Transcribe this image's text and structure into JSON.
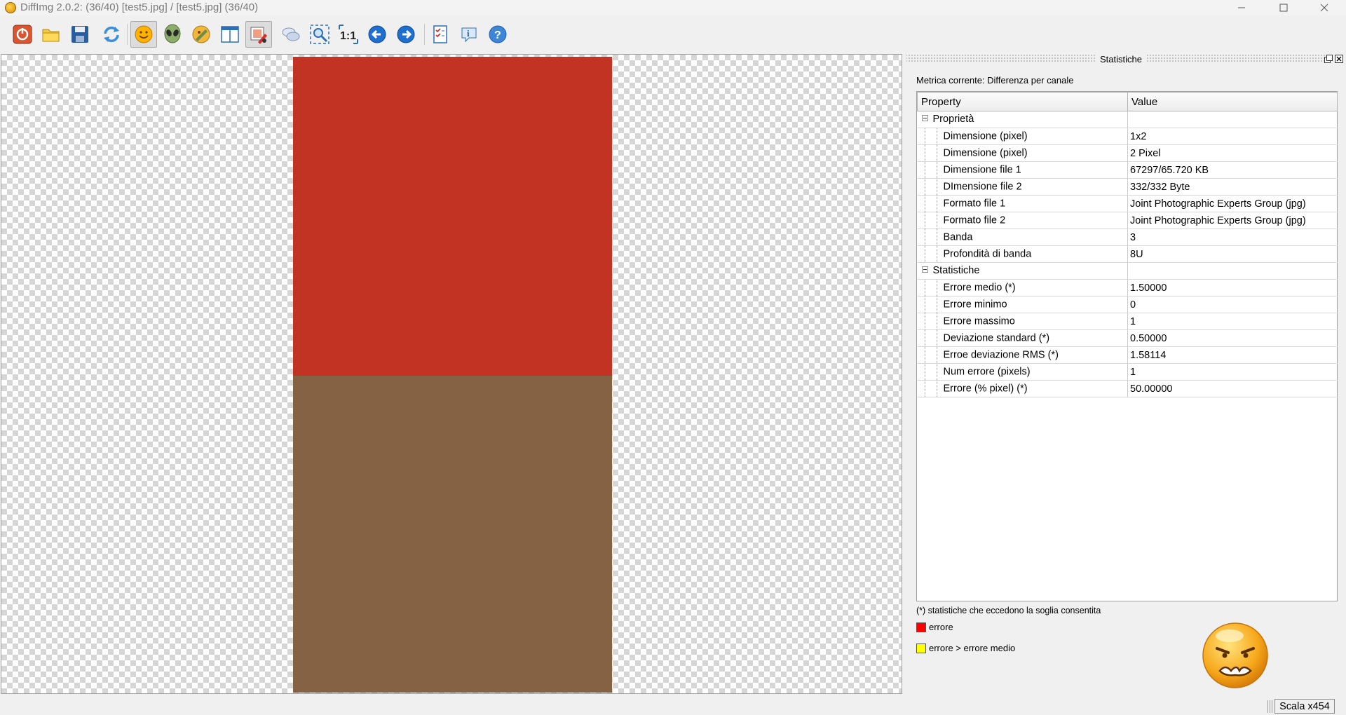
{
  "window": {
    "title": "DiffImg 2.0.2:  (36/40) [test5.jpg] / [test5.jpg] (36/40)"
  },
  "toolbar": {
    "buttons": [
      {
        "icon": "power-icon",
        "pressed": false
      },
      {
        "icon": "open-folder-icon",
        "pressed": false
      },
      {
        "icon": "save-icon",
        "pressed": false
      },
      {
        "icon": "refresh-icon",
        "pressed": false
      },
      {
        "icon": "smiley-icon",
        "pressed": true
      },
      {
        "icon": "alien-icon",
        "pressed": false
      },
      {
        "icon": "paint-blend-icon",
        "pressed": false
      },
      {
        "icon": "split-view-icon",
        "pressed": false
      },
      {
        "icon": "highlight-error-icon",
        "pressed": true
      },
      {
        "icon": "chat-bubbles-icon",
        "pressed": false
      },
      {
        "icon": "zoom-fit-icon",
        "pressed": false
      },
      {
        "icon": "zoom-1-1-icon",
        "pressed": false
      },
      {
        "icon": "previous-arrow-icon",
        "pressed": false
      },
      {
        "icon": "next-arrow-icon",
        "pressed": false
      },
      {
        "icon": "checklist-icon",
        "pressed": false
      },
      {
        "icon": "info-icon",
        "pressed": false
      },
      {
        "icon": "help-icon",
        "pressed": false
      }
    ]
  },
  "canvas": {
    "pixel_colors": [
      "#c33324",
      "#866245"
    ]
  },
  "stats_panel": {
    "title": "Statistiche",
    "metric_label": "Metrica corrente: Differenza per canale",
    "table": {
      "header_property": "Property",
      "header_value": "Value",
      "groups": [
        {
          "name": "Proprietà",
          "rows": [
            {
              "property": "Dimensione (pixel)",
              "value": "1x2"
            },
            {
              "property": "Dimensione (pixel)",
              "value": "2 Pixel"
            },
            {
              "property": "Dimensione file 1",
              "value": "67297/65.720 KB"
            },
            {
              "property": "DImensione file 2",
              "value": "332/332 Byte"
            },
            {
              "property": "Formato file 1",
              "value": "Joint Photographic Experts Group (jpg)"
            },
            {
              "property": "Formato file 2",
              "value": "Joint Photographic Experts Group (jpg)"
            },
            {
              "property": "Banda",
              "value": "3"
            },
            {
              "property": "Profondità di banda",
              "value": "8U"
            }
          ]
        },
        {
          "name": "Statistiche",
          "rows": [
            {
              "property": "Errore medio (*)",
              "value": "1.50000"
            },
            {
              "property": "Errore minimo",
              "value": "0"
            },
            {
              "property": "Errore massimo",
              "value": "1"
            },
            {
              "property": "Deviazione standard (*)",
              "value": "0.50000"
            },
            {
              "property": "Erroe deviazione RMS (*)",
              "value": "1.58114"
            },
            {
              "property": "Num errore (pixels)",
              "value": "1"
            },
            {
              "property": "Errore (% pixel) (*)",
              "value": "50.00000"
            }
          ]
        }
      ]
    },
    "note": "(*) statistiche che eccedono la soglia consentita",
    "legend": [
      {
        "label": "errore",
        "color": "#ff0000"
      },
      {
        "label": "errore > errore medio",
        "color": "#ffff00"
      }
    ],
    "status_face": "angry-face-icon"
  },
  "statusbar": {
    "scale": "Scala x454"
  }
}
